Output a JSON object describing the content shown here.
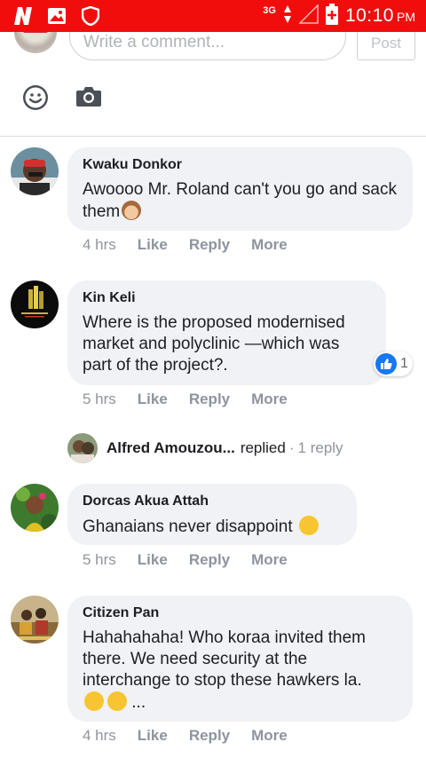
{
  "status_bar": {
    "network": "3G",
    "time": "10:10",
    "ampm": "PM",
    "background": "#f20d0d"
  },
  "composer": {
    "placeholder": "Write a comment...",
    "post_label": "Post"
  },
  "comments": [
    {
      "author": "Kwaku Donkor",
      "text": "Awoooo Mr. Roland can't you go and sack them",
      "time": "4 hrs",
      "like": "Like",
      "reply": "Reply",
      "more": "More"
    },
    {
      "author": "Kin Keli",
      "text": "Where is the proposed modernised market and polyclinic —which was part of the project?.",
      "time": "5 hrs",
      "like": "Like",
      "reply": "Reply",
      "more": "More",
      "reaction_count": "1",
      "reply_summary": {
        "name": "Alfred Amouzou...",
        "verb": "replied",
        "separator": "·",
        "count": "1 reply"
      }
    },
    {
      "author": "Dorcas Akua Attah",
      "text": "Ghanaians never disappoint",
      "time": "5 hrs",
      "like": "Like",
      "reply": "Reply",
      "more": "More"
    },
    {
      "author": "Citizen Pan",
      "text": "Hahahahaha! Who koraa invited them there. We need security at the interchange to stop these hawkers la.",
      "text_tail": "...",
      "time": "4 hrs",
      "like": "Like",
      "reply": "Reply",
      "more": "More"
    }
  ],
  "colors": {
    "bubble": "#f0f2f5",
    "like_blue": "#1877f2",
    "meta_gray": "#90949c"
  }
}
